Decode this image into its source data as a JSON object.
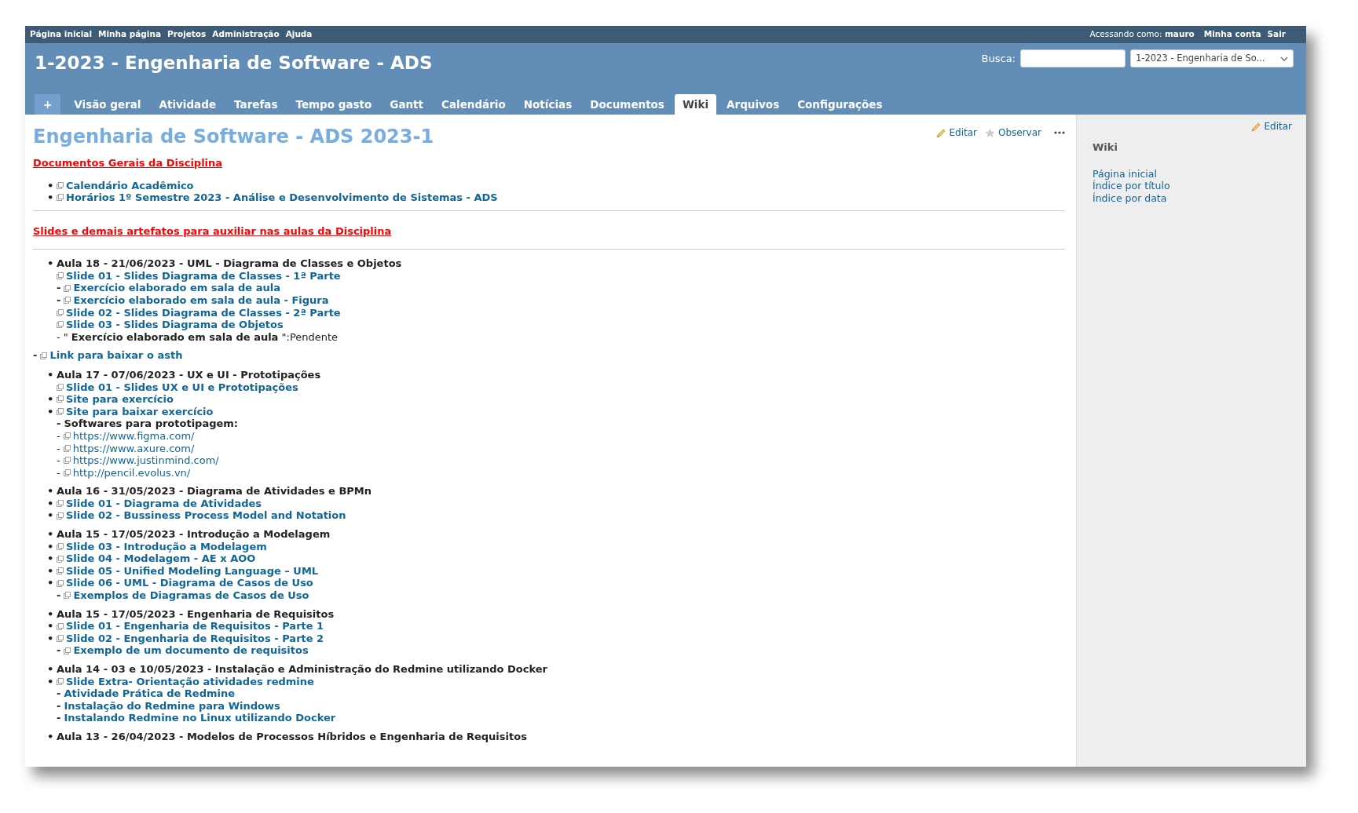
{
  "top_menu": [
    "Página inicial",
    "Minha página",
    "Projetos",
    "Administração",
    "Ajuda"
  ],
  "account": {
    "label": "Acessando como:",
    "user": "mauro",
    "links": [
      "Minha conta",
      "Sair"
    ]
  },
  "project_title": "1-2023 - Engenharia de Software - ADS",
  "search": {
    "label": "Busca:",
    "project": "1-2023 - Engenharia de So..."
  },
  "tabs": [
    {
      "label": "+",
      "kind": "new",
      "selected": false
    },
    {
      "label": "Visão geral",
      "kind": "tab",
      "selected": false
    },
    {
      "label": "Atividade",
      "kind": "tab",
      "selected": false
    },
    {
      "label": "Tarefas",
      "kind": "tab",
      "selected": false
    },
    {
      "label": "Tempo gasto",
      "kind": "tab",
      "selected": false
    },
    {
      "label": "Gantt",
      "kind": "tab",
      "selected": false
    },
    {
      "label": "Calendário",
      "kind": "tab",
      "selected": false
    },
    {
      "label": "Notícias",
      "kind": "tab",
      "selected": false
    },
    {
      "label": "Documentos",
      "kind": "tab",
      "selected": false
    },
    {
      "label": "Wiki",
      "kind": "tab",
      "selected": true
    },
    {
      "label": "Arquivos",
      "kind": "tab",
      "selected": false
    },
    {
      "label": "Configurações",
      "kind": "tab",
      "selected": false
    }
  ],
  "page": {
    "title": "Engenharia de Software - ADS 2023-1",
    "actions": [
      {
        "kind": "edit",
        "label": "Editar"
      },
      {
        "kind": "watch",
        "label": "Observar"
      },
      {
        "kind": "more"
      }
    ],
    "blocks": [
      {
        "kind": "heading",
        "text": "Documentos Gerais da Disciplina"
      },
      {
        "kind": "lines",
        "lines": [
          {
            "bullet": "•",
            "icon": true,
            "kind": "link",
            "text": "Calendário Acadêmico"
          },
          {
            "bullet": "•",
            "icon": true,
            "kind": "link",
            "text": "Horários 1º Semestre 2023 - Análise e Desenvolvimento de Sistemas - ADS"
          }
        ]
      },
      {
        "kind": "rule"
      },
      {
        "kind": "heading",
        "text": "Slides e demais artefatos para auxiliar nas aulas da Disciplina"
      },
      {
        "kind": "rule"
      },
      {
        "kind": "lines",
        "lines": [
          {
            "bullet": "•",
            "icon": false,
            "kind": "strong",
            "text": "Aula 18 - 21/06/2023 - UML - Diagrama de Classes e Objetos"
          },
          {
            "icon": true,
            "kind": "link",
            "text": "Slide 01 - Slides Diagrama de Classes - 1ª Parte"
          },
          {
            "prefix": "-",
            "icon": true,
            "kind": "link",
            "text": "Exercício elaborado em sala de aula"
          },
          {
            "prefix": "-",
            "icon": true,
            "kind": "link",
            "text": "Exercício elaborado em sala de aula - Figura"
          },
          {
            "icon": true,
            "kind": "link",
            "text": "Slide 02 - Slides Diagrama de Classes - 2ª Parte"
          },
          {
            "icon": true,
            "kind": "link",
            "text": "Slide 03 - Slides Diagrama de Objetos"
          },
          {
            "prefix": "-",
            "icon": false,
            "kind": "plain",
            "text": "\" **Exercício elaborado em sala de aula** \":Pendente"
          }
        ]
      },
      {
        "kind": "outer",
        "line": {
          "prefix": "-",
          "icon": true,
          "kind": "link",
          "text": "Link para baixar o asth"
        }
      },
      {
        "kind": "lines",
        "lines": [
          {
            "bullet": "•",
            "icon": false,
            "kind": "strong",
            "text": "Aula 17 - 07/06/2023 - UX e UI - Prototipações"
          },
          {
            "icon": true,
            "kind": "link",
            "text": "Slide 01 - Slides UX e UI e Prototipações"
          },
          {
            "bullet": "•",
            "icon": true,
            "kind": "link",
            "text": "Site para exercício"
          },
          {
            "bullet": "•",
            "icon": true,
            "kind": "link",
            "text": "Site para baixar exercício"
          },
          {
            "prefix": "-",
            "icon": false,
            "kind": "strong",
            "text": "Softwares para prototipagem:"
          },
          {
            "prefix": "-",
            "icon": true,
            "kind": "url",
            "text": "https://www.figma.com/"
          },
          {
            "prefix": "-",
            "icon": true,
            "kind": "url",
            "text": "https://www.axure.com/"
          },
          {
            "prefix": "-",
            "icon": true,
            "kind": "url",
            "text": "https://www.justinmind.com/"
          },
          {
            "prefix": "-",
            "icon": true,
            "kind": "url",
            "text": "http://pencil.evolus.vn/"
          }
        ]
      },
      {
        "kind": "lines",
        "lines": [
          {
            "bullet": "•",
            "icon": false,
            "kind": "strong",
            "text": "Aula 16 - 31/05/2023 - Diagrama de Atividades e BPMn"
          },
          {
            "bullet": "•",
            "icon": true,
            "kind": "link",
            "text": "Slide 01 - Diagrama de Atividades"
          },
          {
            "bullet": "•",
            "icon": true,
            "kind": "link",
            "text": "Slide 02 - Bussiness Process Model and Notation"
          }
        ]
      },
      {
        "kind": "lines",
        "lines": [
          {
            "bullet": "•",
            "icon": false,
            "kind": "strong",
            "text": "Aula 15 - 17/05/2023 - Introdução a Modelagem"
          },
          {
            "bullet": "•",
            "icon": true,
            "kind": "link",
            "text": "Slide 03 - Introdução a Modelagem"
          },
          {
            "bullet": "•",
            "icon": true,
            "kind": "link",
            "text": "Slide 04 - Modelagem - AE x AOO"
          },
          {
            "bullet": "•",
            "icon": true,
            "kind": "link",
            "text": "Slide 05 - Unified Modeling Language – UML"
          },
          {
            "bullet": "•",
            "icon": true,
            "kind": "link",
            "text": "Slide 06 - UML - Diagrama de Casos de Uso"
          },
          {
            "prefix": "-",
            "icon": true,
            "kind": "link",
            "text": "Exemplos de Diagramas de Casos de Uso"
          }
        ]
      },
      {
        "kind": "lines",
        "lines": [
          {
            "bullet": "•",
            "icon": false,
            "kind": "strong",
            "text": "Aula 15 - 17/05/2023 - Engenharia de Requisitos"
          },
          {
            "bullet": "•",
            "icon": true,
            "kind": "link",
            "text": "Slide 01 - Engenharia de Requisitos - Parte 1"
          },
          {
            "bullet": "•",
            "icon": true,
            "kind": "link",
            "text": "Slide 02 - Engenharia de Requisitos - Parte 2"
          },
          {
            "prefix": "-",
            "icon": true,
            "kind": "link",
            "text": "Exemplo de um documento de requisitos"
          }
        ]
      },
      {
        "kind": "lines",
        "lines": [
          {
            "bullet": "•",
            "icon": false,
            "kind": "strong",
            "text": "Aula 14 - 03 e 10/05/2023 - Instalação e Administração do Redmine utilizando Docker"
          },
          {
            "bullet": "•",
            "icon": true,
            "kind": "link",
            "text": "Slide Extra- Orientação atividades redmine"
          },
          {
            "prefix": "-",
            "icon": false,
            "kind": "link",
            "text": "Atividade Prática de Redmine"
          },
          {
            "prefix": "-",
            "icon": false,
            "kind": "link",
            "text": "Instalação do Redmine para Windows"
          },
          {
            "prefix": "-",
            "icon": false,
            "kind": "link",
            "text": "Instalando Redmine no Linux utilizando Docker"
          }
        ]
      },
      {
        "kind": "lines",
        "lines": [
          {
            "bullet": "•",
            "icon": false,
            "kind": "strong",
            "text": "Aula 13 - 26/04/2023 - Modelos de Processos Híbridos e Engenharia de Requisitos"
          }
        ]
      }
    ]
  },
  "sidebar": {
    "edit": "Editar",
    "title": "Wiki",
    "links": [
      "Página inicial",
      "Índice por título",
      "Índice por data"
    ]
  }
}
